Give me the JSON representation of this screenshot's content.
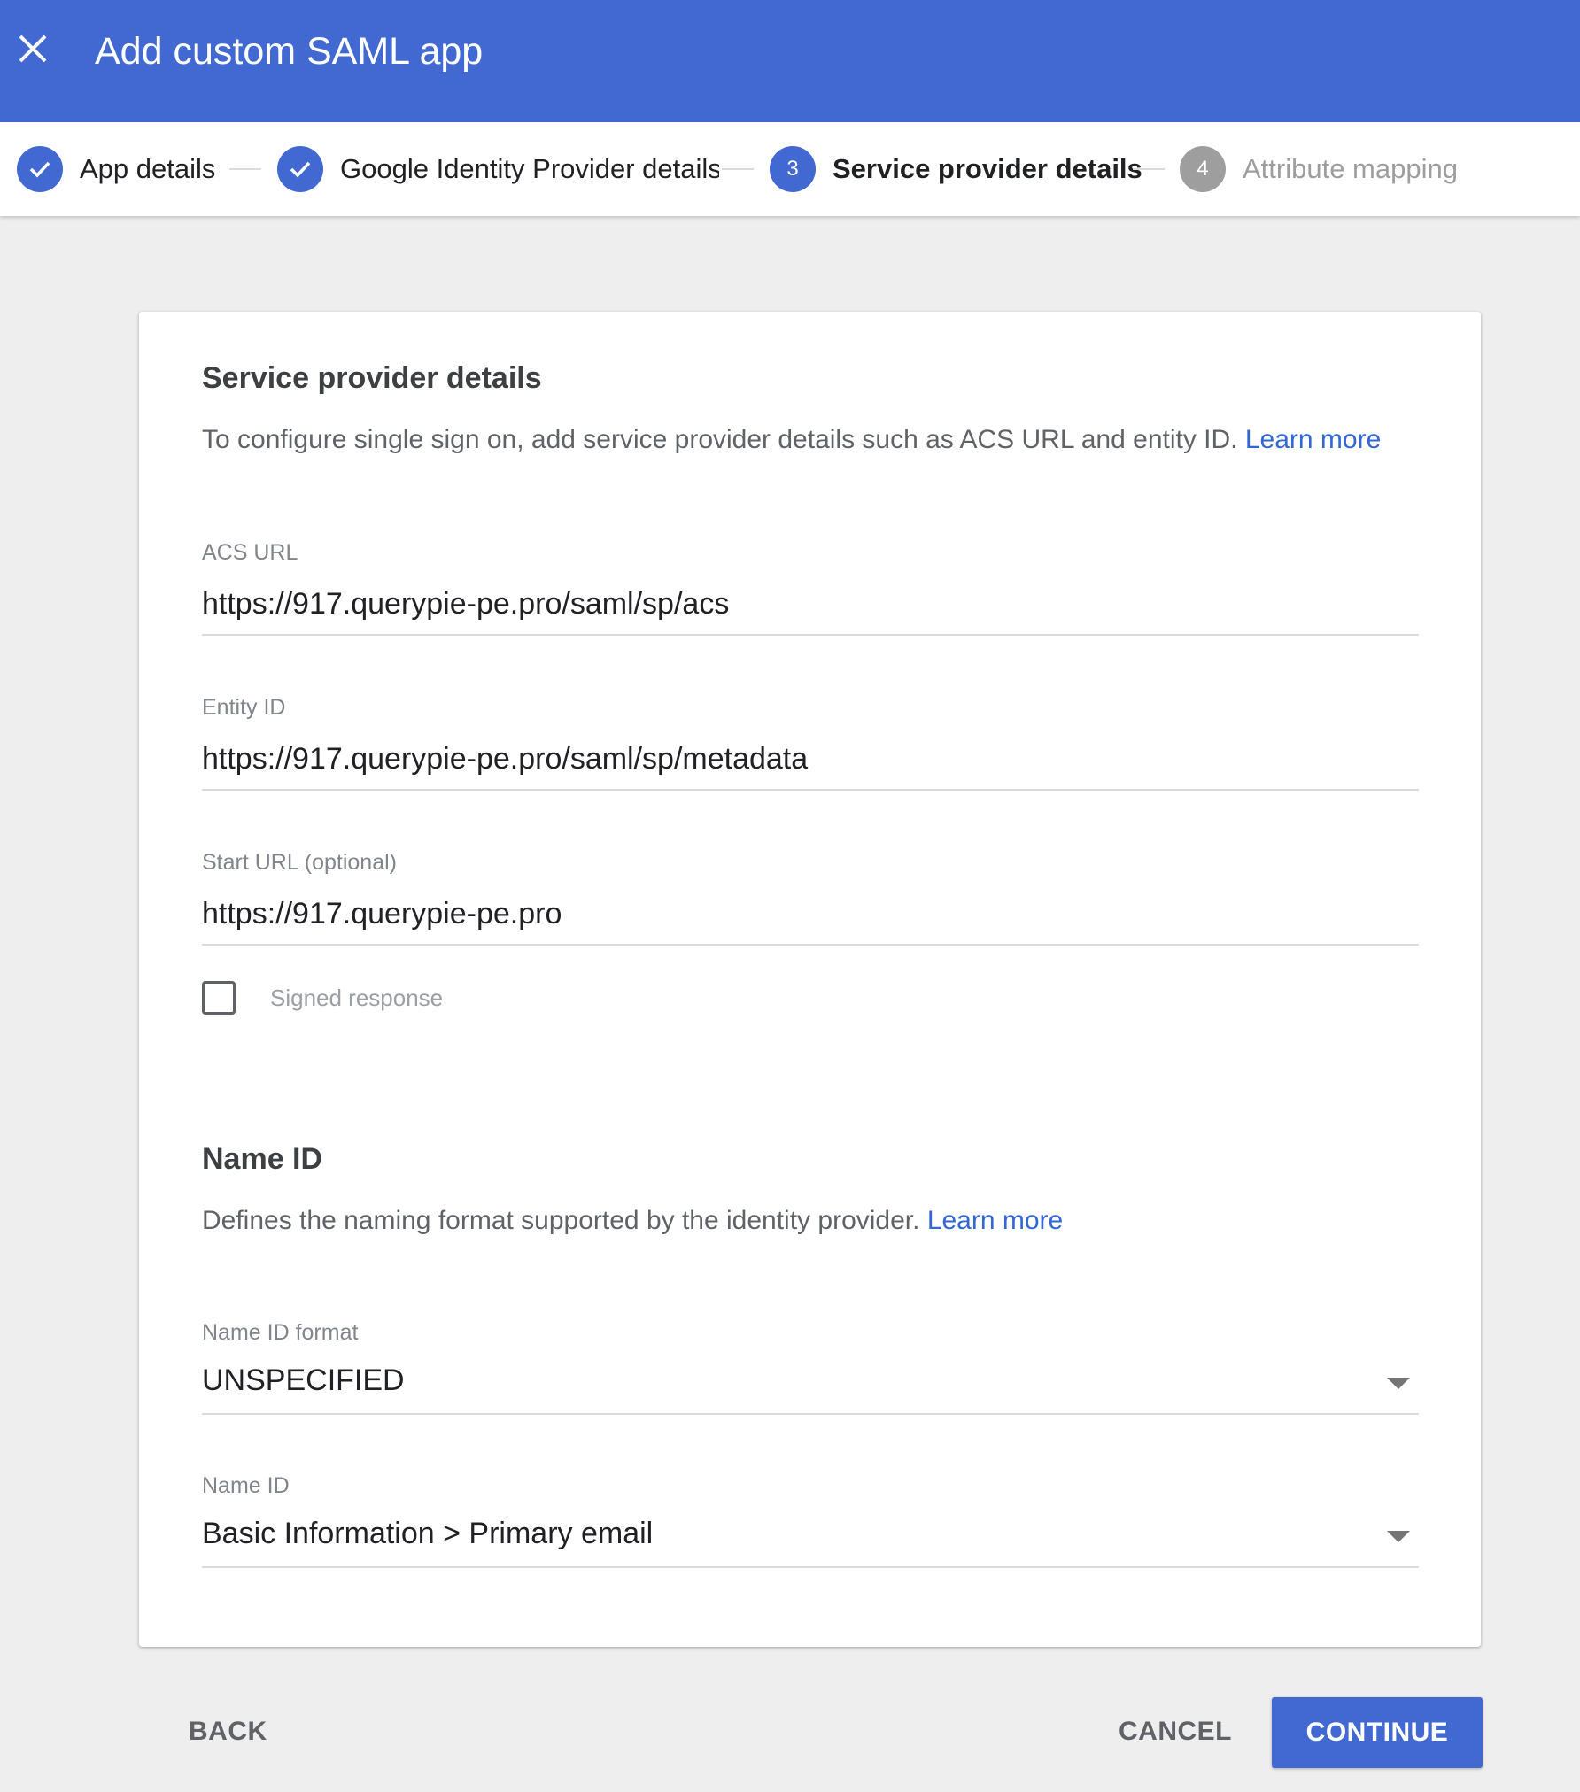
{
  "header": {
    "title": "Add custom SAML app",
    "close_icon": "close-icon",
    "background_color": "#4169d1"
  },
  "stepper": {
    "steps": [
      {
        "label": "App details",
        "state": "done",
        "number": "1"
      },
      {
        "label": "Google Identity Provider details",
        "state": "done",
        "number": "2"
      },
      {
        "label": "Service provider details",
        "state": "active",
        "number": "3"
      },
      {
        "label": "Attribute mapping",
        "state": "pending",
        "number": "4"
      }
    ]
  },
  "service_provider": {
    "title": "Service provider details",
    "description": "To configure single sign on, add service provider details such as ACS URL and entity ID.",
    "learn_more": "Learn more",
    "acs_url": {
      "label": "ACS URL",
      "value": "https://917.querypie-pe.pro/saml/sp/acs"
    },
    "entity_id": {
      "label": "Entity ID",
      "value": "https://917.querypie-pe.pro/saml/sp/metadata"
    },
    "start_url": {
      "label": "Start URL (optional)",
      "value": "https://917.querypie-pe.pro"
    },
    "signed_response": {
      "label": "Signed response",
      "checked": false
    }
  },
  "name_id": {
    "title": "Name ID",
    "description": "Defines the naming format supported by the identity provider.",
    "learn_more": "Learn more",
    "format": {
      "label": "Name ID format",
      "value": "UNSPECIFIED"
    },
    "name_id_field": {
      "label": "Name ID",
      "value": "Basic Information > Primary email"
    }
  },
  "footer": {
    "back_label": "BACK",
    "cancel_label": "CANCEL",
    "continue_label": "CONTINUE"
  }
}
